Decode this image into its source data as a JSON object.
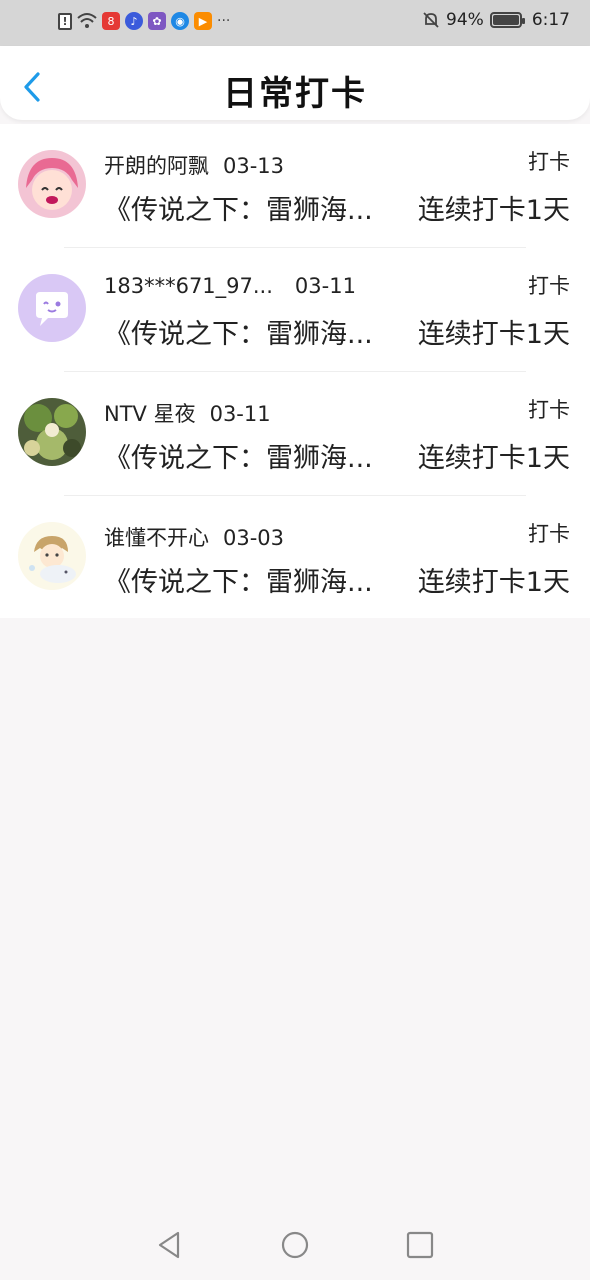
{
  "status_bar": {
    "battery": "94%",
    "time": "6:17",
    "more": "···"
  },
  "header": {
    "title": "日常打卡"
  },
  "records": [
    {
      "user": "开朗的阿飘",
      "date": "03-13",
      "action": "打卡",
      "description": "《传说之下：雷狮海...",
      "streak": "连续打卡1天"
    },
    {
      "user": "183***671_97...",
      "date": "03-11",
      "action": "打卡",
      "description": "《传说之下：雷狮海...",
      "streak": "连续打卡1天"
    },
    {
      "user": "NTV 星夜",
      "date": "03-11",
      "action": "打卡",
      "description": "《传说之下：雷狮海...",
      "streak": "连续打卡1天"
    },
    {
      "user": "谁懂不开心",
      "date": "03-03",
      "action": "打卡",
      "description": "《传说之下：雷狮海...",
      "streak": "连续打卡1天"
    }
  ],
  "colors": {
    "accent": "#1e9be9",
    "status_bar_bg": "#d6d6d6",
    "page_bg": "#f8f6f7"
  }
}
